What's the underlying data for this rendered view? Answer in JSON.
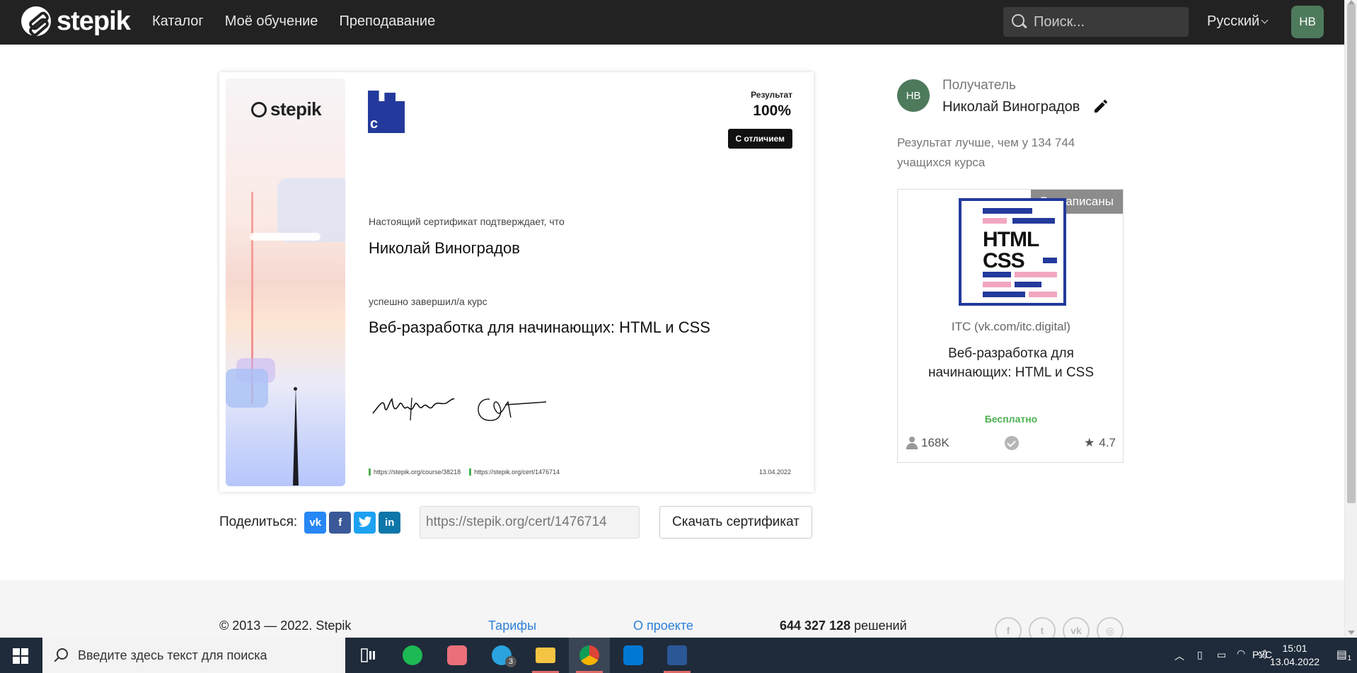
{
  "header": {
    "brand": "stepik",
    "nav": [
      "Каталог",
      "Моё обучение",
      "Преподавание"
    ],
    "search_placeholder": "Поиск...",
    "language": "Русский",
    "user_initials": "НВ"
  },
  "certificate": {
    "brand": "stepik",
    "result_label": "Результат",
    "result_value": "100%",
    "distinction": "С отличием",
    "confirms_text": "Настоящий сертификат подтверждает, что",
    "recipient_name": "Николай Виноградов",
    "completed_text": "успешно завершил/а  курс",
    "course_title": "Веб-разработка для начинающих: HTML и CSS",
    "course_link": "https://stepik.org/course/38218",
    "cert_link": "https://stepik.org/cert/1476714",
    "date": "13.04.2022"
  },
  "share": {
    "label": "Поделиться:",
    "url": "https://stepik.org/cert/1476714",
    "download_label": "Скачать сертификат",
    "networks": [
      "vk-icon",
      "facebook-icon",
      "twitter-icon",
      "linkedin-icon"
    ]
  },
  "recipient": {
    "initials": "НВ",
    "label": "Получатель",
    "name": "Николай Виноградов",
    "better_than": "Результат лучше, чем у 134 744 учащихся курса"
  },
  "course_card": {
    "badge": "Вы записаны",
    "thumb_line1": "HTML",
    "thumb_line2": "CSS",
    "author": "ITC (vk.com/itc.digital)",
    "title": "Веб-разработка для начинающих: HTML и CSS",
    "price": "Бесплатно",
    "learners": "168K",
    "rating": "4.7"
  },
  "footer": {
    "copyright": "© 2013 — 2022. Stepik",
    "link1": "Тарифы",
    "link2": "О проекте",
    "solved_count": "644 327 128",
    "solved_label": "решений"
  },
  "taskbar": {
    "search_text": "Введите здесь текст для поиска",
    "lang": "РУС",
    "time": "15:01",
    "date": "13.04.2022",
    "telegram_badge": "3",
    "notifications": "1"
  },
  "colors": {
    "header_bg": "#222222",
    "accent_green": "#4caf50",
    "link_blue": "#2d7fd8",
    "avatar_green": "#4e7a5c",
    "course_blue": "#233a9c"
  }
}
